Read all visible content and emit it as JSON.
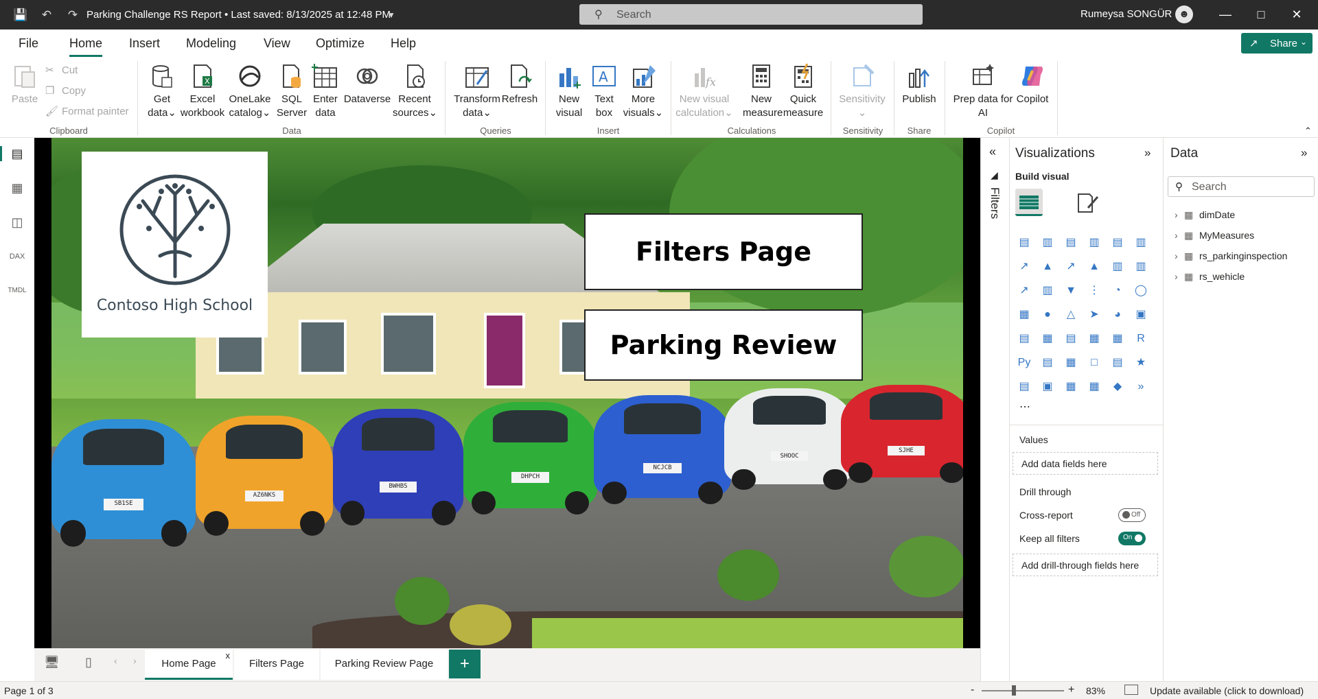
{
  "titlebar": {
    "doc_title": "Parking Challenge RS Report • Last saved: 8/13/2025 at 12:48 PM",
    "search_placeholder": "Search",
    "user_name": "Rumeysa SONGÜR"
  },
  "menu": {
    "tabs": [
      "File",
      "Home",
      "Insert",
      "Modeling",
      "View",
      "Optimize",
      "Help"
    ],
    "active": "Home",
    "share_label": "Share"
  },
  "ribbon": {
    "clipboard": {
      "paste": "Paste",
      "cut": "Cut",
      "copy": "Copy",
      "format_painter": "Format painter",
      "label": "Clipboard"
    },
    "data": {
      "get_data": [
        "Get",
        "data"
      ],
      "excel": [
        "Excel",
        "workbook"
      ],
      "onelake": [
        "OneLake",
        "catalog"
      ],
      "sql": [
        "SQL",
        "Server"
      ],
      "enter": [
        "Enter",
        "data"
      ],
      "dataverse": [
        "Dataverse",
        ""
      ],
      "recent": [
        "Recent",
        "sources"
      ],
      "label": "Data"
    },
    "queries": {
      "transform": [
        "Transform",
        "data"
      ],
      "refresh": [
        "Refresh",
        ""
      ],
      "label": "Queries"
    },
    "insert": {
      "new_visual": [
        "New",
        "visual"
      ],
      "text_box": [
        "Text",
        "box"
      ],
      "more_visuals": [
        "More",
        "visuals"
      ],
      "label": "Insert"
    },
    "calculations": {
      "new_visual_calc": [
        "New visual",
        "calculation"
      ],
      "new_measure": [
        "New",
        "measure"
      ],
      "quick_measure": [
        "Quick",
        "measure"
      ],
      "label": "Calculations"
    },
    "sensitivity": {
      "btn": [
        "Sensitivity",
        ""
      ],
      "label": "Sensitivity"
    },
    "share": {
      "publish": [
        "Publish",
        ""
      ],
      "label": "Share"
    },
    "copilot": {
      "prep": [
        "Prep data for",
        "AI"
      ],
      "copilot": [
        "Copilot",
        ""
      ],
      "label": "Copilot"
    }
  },
  "canvas": {
    "logo_text": "Contoso High School",
    "cards": [
      "Filters Page",
      "Parking Review"
    ],
    "plates": [
      "SB1SE",
      "AZ6NKS",
      "BWHBS",
      "DHPCH",
      "NCJCB",
      "SHOOC",
      "SJHE"
    ]
  },
  "filters_pane": {
    "label": "Filters"
  },
  "visualizations": {
    "title": "Visualizations",
    "build_visual": "Build visual",
    "values_label": "Values",
    "values_placeholder": "Add data fields here",
    "drill_through": "Drill through",
    "cross_report": "Cross-report",
    "cross_report_state": "Off",
    "keep_filters": "Keep all filters",
    "keep_filters_state": "On",
    "drill_placeholder": "Add drill-through fields here"
  },
  "data_pane": {
    "title": "Data",
    "search_placeholder": "Search",
    "tables": [
      "dimDate",
      "MyMeasures",
      "rs_parkinginspection",
      "rs_wehicle"
    ]
  },
  "pages": {
    "tabs": [
      "Home Page",
      "Filters Page",
      "Parking Review Page"
    ],
    "active": "Home Page",
    "close": "x"
  },
  "status": {
    "page_info": "Page 1 of 3",
    "zoom": "83%",
    "update": "Update available (click to download)"
  },
  "colors": {
    "accent": "#117865",
    "titlebar": "#2b2b2b"
  }
}
